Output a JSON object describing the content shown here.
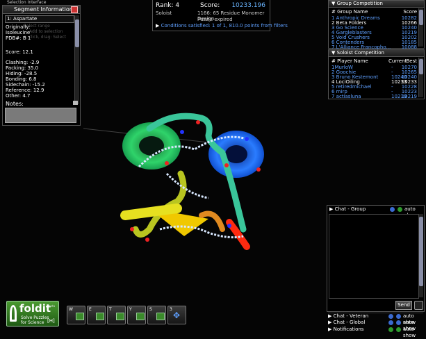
{
  "app_title": "Selection Interface",
  "segment_info": {
    "title": "Segment Information",
    "dropdown": "1: Aspartate",
    "originally_label": "Originally:",
    "originally_value": "Isoleucine",
    "pdb": "PDB#: B 1",
    "hint_lines": [
      "Select range",
      "Add to selection",
      "e, click, drag: Select"
    ],
    "score": "Score: 12.1",
    "stats": [
      "Clashing: -2.9",
      "Packing: 35.0",
      "Hiding: -28.5",
      "Bonding: 6.8",
      "Sidechain: -15.2",
      "Reference: 12.9",
      "Other: 4.7"
    ],
    "notes_label": "Notes:"
  },
  "top_info": {
    "rank_label": "Rank: 4",
    "score_label": "Score:",
    "score_value": "10233.196",
    "role": "Soloist",
    "puzzle_name": "1166: 65 Residue Monomer Design",
    "status": "Puzzle expired",
    "conditions": "Conditions satisfied: 1 of 1, 810.0 points from filters"
  },
  "group_competition": {
    "title": "Group Competition",
    "col_name": "# Group Name",
    "col_score": "Score",
    "rows": [
      {
        "name": "1 Anthropic Dreams",
        "score": "10282",
        "highlight": false
      },
      {
        "name": "2 Beta Folders",
        "score": "10266",
        "highlight": true
      },
      {
        "name": "3 Go Science",
        "score": "10240",
        "highlight": false
      },
      {
        "name": "4 Gargleblasters",
        "score": "10219",
        "highlight": false
      },
      {
        "name": "5 Void Crushers",
        "score": "10202",
        "highlight": false
      },
      {
        "name": "6 Contenders",
        "score": "10185",
        "highlight": false
      },
      {
        "name": "7 L'Alliance Francopho...",
        "score": "10088",
        "highlight": false
      }
    ]
  },
  "soloist_competition": {
    "title": "Soloist Competition",
    "col_name": "# Player Name",
    "col_current": "Current",
    "col_best": "Best",
    "rows": [
      {
        "name": "1MurloW",
        "current": "-",
        "best": "10270",
        "highlight": false
      },
      {
        "name": "2 Goochie",
        "current": "-",
        "best": "10265",
        "highlight": false
      },
      {
        "name": "3 Bruno Kestemont",
        "current": "10240",
        "best": "10240",
        "highlight": false
      },
      {
        "name": "4 LociOiling",
        "current": "10233",
        "best": "10233",
        "highlight": true
      },
      {
        "name": "5 retiredmichael",
        "current": "-",
        "best": "10228",
        "highlight": false
      },
      {
        "name": "6 mirp",
        "current": "-",
        "best": "10223",
        "highlight": false
      },
      {
        "name": "7 actiasluna",
        "current": "10219",
        "best": "10219",
        "highlight": false
      }
    ]
  },
  "chat": {
    "group": "Chat - Group",
    "veteran": "Chat - Veteran",
    "global": "Chat - Global",
    "notifications": "Notifications",
    "auto_show": "auto show",
    "send": "Send"
  },
  "toolbar": {
    "w": "W",
    "e": "E",
    "t": "T",
    "y": "Y",
    "s": "S",
    "num3": "3"
  },
  "logo": {
    "name": "foldit",
    "tagline1": "Solve Puzzles",
    "tagline2": "for Science",
    "beta": "beta",
    "badge": "[H]"
  },
  "colors": {
    "accent_blue": "#5fa0ff",
    "score_cyan": "#69b4ff",
    "logo_green": "#2f7a20"
  }
}
